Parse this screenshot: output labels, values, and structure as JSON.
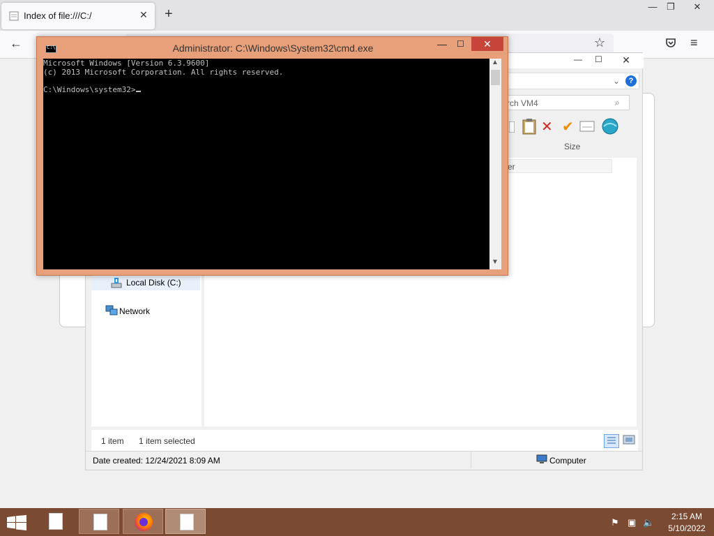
{
  "browser": {
    "tab_title": "Index of file:///C:/",
    "tab_close": "✕",
    "new_tab": "+",
    "window_minimize": "—",
    "window_restore": "❐",
    "window_close": "✕",
    "back": "←",
    "star": "☆",
    "menu": "≡"
  },
  "explorer": {
    "search_placeholder": "rch VM4",
    "column_size": "Size",
    "row_partial": "er",
    "nav_local_disk": "Local Disk (C:)",
    "nav_network": "Network",
    "status_items": "1 item",
    "status_selected": "1 item selected",
    "date_created": "Date created: 12/24/2021 8:09 AM",
    "computer": "Computer",
    "help": "?"
  },
  "cmd": {
    "title": "Administrator: C:\\Windows\\System32\\cmd.exe",
    "icon_text": "C:\\",
    "console_text": "Microsoft Windows [Version 6.3.9600]\n(c) 2013 Microsoft Corporation. All rights reserved.\n\nC:\\Windows\\system32>"
  },
  "taskbar": {
    "clock_time": "2:15 AM",
    "clock_date": "5/10/2022"
  },
  "colors": {
    "cmd_frame": "#e8a07a",
    "cmd_close": "#c7443b",
    "taskbar": "#7a4a32",
    "explorer_help": "#1e6fd9"
  }
}
